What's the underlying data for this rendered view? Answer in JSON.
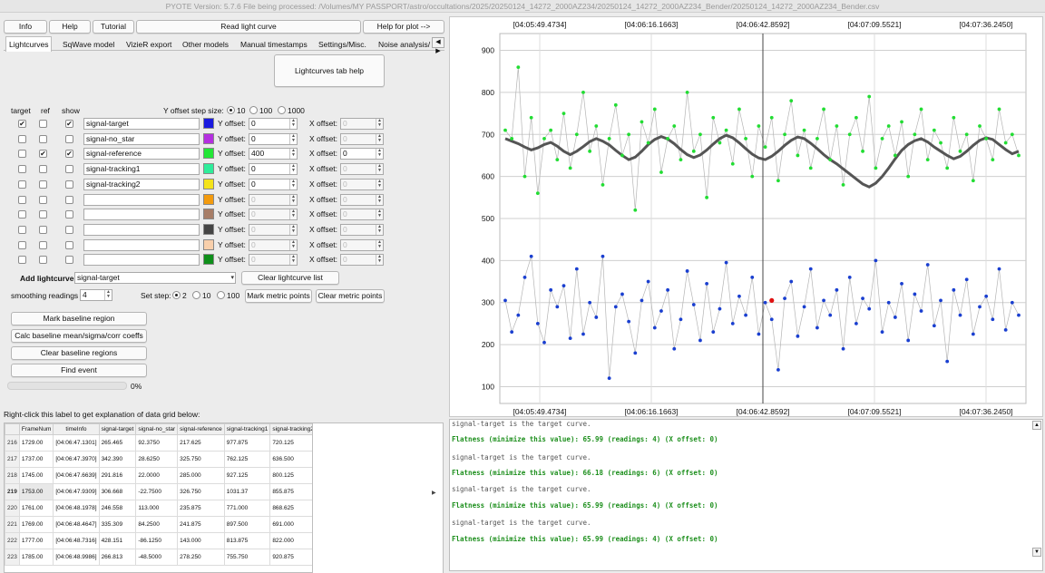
{
  "window_title": "PYOTE Version: 5.7.6  File being processed: /Volumes/MY PASSPORT/astro/occultations/2025/20250124_14272_2000AZ234/20250124_14272_2000AZ234_Bender/20250124_14272_2000AZ234_Bender.csv",
  "toolbar": {
    "info": "Info",
    "help": "Help",
    "tutorial": "Tutorial",
    "read_light_curve": "Read light curve",
    "help_for_plot": "Help for plot -->"
  },
  "tabs": [
    "Lightcurves",
    "SqWave model",
    "VizieR export",
    "Other models",
    "Manual timestamps",
    "Settings/Misc.",
    "Noise analysis/"
  ],
  "tab_scroll": "◀ ▶",
  "lightcurves_help": "Lightcurves tab help",
  "headers": {
    "target": "target",
    "ref": "ref",
    "show": "show",
    "y_step": "Y offset step size:"
  },
  "y_step_options": [
    "10",
    "100",
    "1000"
  ],
  "offset_labels": {
    "y": "Y offset:",
    "x": "X offset:"
  },
  "rows": [
    {
      "target": "✔",
      "ref": "",
      "show": "✔",
      "name": "signal-target",
      "color": "#1a1adf",
      "y": "0",
      "x": "0",
      "enabled": true
    },
    {
      "target": "",
      "ref": "",
      "show": "",
      "name": "signal-no_star",
      "color": "#b42fe0",
      "y": "0",
      "x": "0",
      "enabled": true
    },
    {
      "target": "",
      "ref": "✔",
      "show": "✔",
      "name": "signal-reference",
      "color": "#22e636",
      "y": "400",
      "x": "0",
      "enabled": true
    },
    {
      "target": "",
      "ref": "",
      "show": "",
      "name": "signal-tracking1",
      "color": "#2eec9a",
      "y": "0",
      "x": "0",
      "enabled": true
    },
    {
      "target": "",
      "ref": "",
      "show": "",
      "name": "signal-tracking2",
      "color": "#f4e31a",
      "y": "0",
      "x": "0",
      "enabled": true
    },
    {
      "target": "",
      "ref": "",
      "show": "",
      "name": "",
      "color": "#f39b0e",
      "y": "0",
      "x": "0",
      "enabled": false
    },
    {
      "target": "",
      "ref": "",
      "show": "",
      "name": "",
      "color": "#a77d67",
      "y": "0",
      "x": "0",
      "enabled": false
    },
    {
      "target": "",
      "ref": "",
      "show": "",
      "name": "",
      "color": "#444444",
      "y": "0",
      "x": "0",
      "enabled": false
    },
    {
      "target": "",
      "ref": "",
      "show": "",
      "name": "",
      "color": "#f8cfab",
      "y": "0",
      "x": "0",
      "enabled": false
    },
    {
      "target": "",
      "ref": "",
      "show": "",
      "name": "",
      "color": "#0e8f1a",
      "y": "0",
      "x": "0",
      "enabled": false
    }
  ],
  "add_lightcurve": {
    "label": "Add lightcurve",
    "value": "signal-target"
  },
  "clear_lightcurve_list": "Clear lightcurve list",
  "smoothing": {
    "label": "smoothing readings",
    "value": "4"
  },
  "set_step": {
    "label": "Set step:",
    "options": [
      "2",
      "10",
      "100"
    ]
  },
  "mark_metric_points": "Mark metric points",
  "clear_metric_points": "Clear metric points",
  "mark_baseline_region": "Mark baseline region",
  "calc_baseline": "Calc baseline mean/sigma/corr coeffs",
  "clear_baseline_regions": "Clear baseline regions",
  "find_event": "Find event",
  "progress": {
    "value": 0,
    "text": "0%"
  },
  "grid_title": "Right-click this label to get explanation of data grid below:",
  "grid": {
    "columns": [
      "",
      "FrameNum",
      "timeInfo",
      "signal-target",
      "signal-no_star",
      "signal-reference",
      "signal-tracking1",
      "signal-tracking2"
    ],
    "rows": [
      [
        "216",
        "1729.00",
        "[04:06:47.1301]",
        "265.465",
        "92.3750",
        "217.625",
        "977.875",
        "720.125"
      ],
      [
        "217",
        "1737.00",
        "[04:06:47.3970]",
        "342.390",
        "28.6250",
        "325.750",
        "762.125",
        "636.500"
      ],
      [
        "218",
        "1745.00",
        "[04:06:47.6639]",
        "291.816",
        "22.0000",
        "285.000",
        "927.125",
        "800.125"
      ],
      [
        "219",
        "1753.00",
        "[04:06:47.9309]",
        "306.668",
        "-22.7500",
        "326.750",
        "1031.37",
        "855.875"
      ],
      [
        "220",
        "1761.00",
        "[04:06:48.1978]",
        "246.558",
        "113.000",
        "235.875",
        "771.000",
        "868.625"
      ],
      [
        "221",
        "1769.00",
        "[04:06:48.4647]",
        "335.309",
        "84.2500",
        "241.875",
        "897.500",
        "691.000"
      ],
      [
        "222",
        "1777.00",
        "[04:06:48.7316]",
        "428.151",
        "-86.1250",
        "143.000",
        "813.875",
        "822.000"
      ],
      [
        "223",
        "1785.00",
        "[04:06:48.9986]",
        "266.813",
        "-48.5000",
        "278.250",
        "755.750",
        "920.875"
      ]
    ]
  },
  "log": [
    {
      "text": "signal-target is the target curve.",
      "style": "gray"
    },
    {
      "text": "Flatness (minimize this value): 65.99 (readings: 4) (X offset: 0)",
      "style": "green"
    },
    {
      "text": "signal-target is the target curve.",
      "style": "gray"
    },
    {
      "text": "Flatness (minimize this value): 66.18 (readings: 6) (X offset: 0)",
      "style": "green"
    },
    {
      "text": "signal-target is the target curve.",
      "style": "gray"
    },
    {
      "text": "Flatness (minimize this value): 65.99 (readings: 4) (X offset: 0)",
      "style": "green"
    },
    {
      "text": "signal-target is the target curve.",
      "style": "gray"
    },
    {
      "text": "Flatness (minimize this value): 65.99 (readings: 4) (X offset: 0)",
      "style": "green"
    }
  ],
  "chart_data": {
    "type": "scatter",
    "x_ticks": [
      "[04:05:49.4734]",
      "[04:06:16.1663]",
      "[04:06:42.8592]",
      "[04:07:09.5521]",
      "[04:07:36.2450]"
    ],
    "y_ticks": [
      100,
      200,
      300,
      400,
      500,
      600,
      700,
      800,
      900
    ],
    "ylim": [
      60,
      940
    ],
    "grid": true,
    "colors": {
      "target": "#1a3fd0",
      "reference": "#22dd33",
      "smoothed": "#555555",
      "marker": "#e01010"
    },
    "series": [
      {
        "values": [
          305,
          230,
          270,
          360,
          410,
          250,
          205,
          330,
          290,
          340,
          215,
          380,
          225,
          300,
          265,
          410,
          120,
          290,
          320,
          255,
          180,
          305,
          350,
          240,
          280,
          330,
          190,
          260,
          375,
          295,
          210,
          345,
          230,
          285,
          395,
          250,
          315,
          270,
          360,
          225,
          300,
          260,
          140,
          310,
          350,
          220,
          290,
          380,
          240,
          305,
          270,
          330,
          190,
          360,
          250,
          310,
          285,
          400,
          230,
          300,
          265,
          345,
          210,
          320,
          280,
          390,
          245,
          305,
          160,
          330,
          270,
          355,
          225,
          290,
          315,
          260,
          380,
          235,
          300,
          270
        ]
      },
      {
        "values": [
          710,
          690,
          860,
          600,
          740,
          560,
          690,
          710,
          640,
          750,
          620,
          700,
          800,
          660,
          720,
          580,
          690,
          770,
          650,
          700,
          520,
          730,
          680,
          760,
          610,
          690,
          720,
          640,
          800,
          660,
          700,
          550,
          740,
          680,
          710,
          630,
          760,
          690,
          600,
          720,
          670,
          740,
          590,
          700,
          780,
          650,
          710,
          620,
          690,
          760,
          640,
          720,
          580,
          700,
          740,
          660,
          790,
          620,
          690,
          720,
          650,
          730,
          600,
          700,
          760,
          640,
          710,
          680,
          620,
          740,
          660,
          700,
          590,
          720,
          690,
          640,
          760,
          680,
          700,
          650
        ]
      },
      {
        "values": [
          690,
          684,
          678,
          670,
          663,
          668,
          676,
          681,
          672,
          660,
          652,
          660,
          671,
          683,
          690,
          684,
          675,
          662,
          650,
          640,
          646,
          660,
          676,
          688,
          695,
          689,
          678,
          664,
          652,
          645,
          651,
          663,
          677,
          690,
          698,
          692,
          680,
          666,
          653,
          644,
          640,
          648,
          660,
          674,
          686,
          694,
          690,
          679,
          666,
          652,
          640,
          630,
          618,
          606,
          594,
          582,
          575,
          584,
          600,
          620,
          642,
          662,
          676,
          685,
          690,
          682,
          670,
          660,
          650,
          642,
          648,
          660,
          674,
          686,
          692,
          688,
          676,
          664,
          654,
          660
        ]
      }
    ],
    "marker": {
      "x_index": 41,
      "y": 305
    }
  }
}
